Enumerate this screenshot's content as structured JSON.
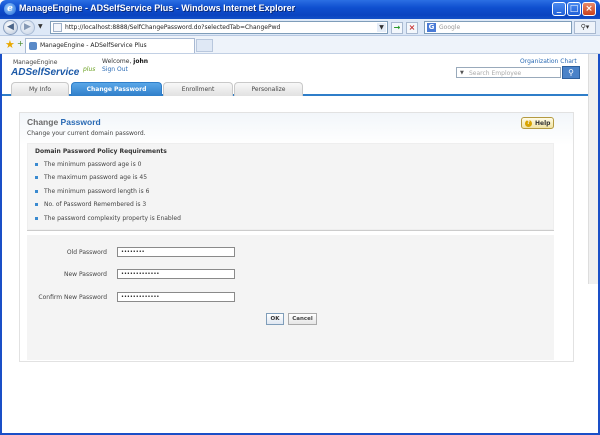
{
  "window": {
    "title": "ManageEngine - ADSelfService Plus - Windows Internet Explorer",
    "minimize": "_",
    "maximize": "□",
    "close": "×"
  },
  "addressbar": {
    "url": "http://localhost:8888/SelfChangePassword.do?selectedTab=ChangePwd",
    "search_placeholder": "Google"
  },
  "browser_tab": {
    "label": "ManageEngine - ADSelfService Plus"
  },
  "header": {
    "logo_small": "ManageEngine",
    "logo_big": "ADSelfService",
    "logo_plus": "plus",
    "welcome_prefix": "Welcome,",
    "user": "john",
    "signout": "Sign Out",
    "org_chart": "Organization Chart",
    "search_placeholder": "Search Employee"
  },
  "nav": {
    "tabs": [
      {
        "label": "My Info"
      },
      {
        "label": "Change Password"
      },
      {
        "label": "Enrollment"
      },
      {
        "label": "Personalize"
      }
    ]
  },
  "panel": {
    "title_part1": "Change",
    "title_part2": "Password",
    "subtitle": "Change your current domain password.",
    "help": "Help",
    "policy_title": "Domain Password Policy Requirements",
    "rules": [
      "The minimum password age is 0",
      "The maximum password age is 45",
      "The minimum password length is 6",
      "No. of Password Remembered is 3",
      "The password complexity property is Enabled"
    ],
    "fields": [
      {
        "label": "Old Password",
        "value": "••••••••"
      },
      {
        "label": "New Password",
        "value": "•••••••••••••"
      },
      {
        "label": "Confirm New Password",
        "value": "•••••••••••••"
      }
    ],
    "ok": "OK",
    "cancel": "Cancel"
  }
}
